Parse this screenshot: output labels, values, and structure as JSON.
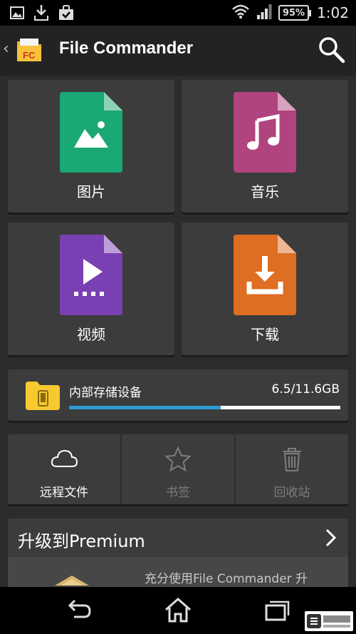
{
  "status_bar": {
    "time": "1:02",
    "battery": "95%",
    "icons": [
      "image-notification-icon",
      "download-notification-icon",
      "store-notification-icon",
      "wifi-icon",
      "signal-icon",
      "battery-icon"
    ]
  },
  "app_bar": {
    "title": "File Commander",
    "logo_text": "FC",
    "icons": [
      "back-chevron-icon",
      "app-logo-icon",
      "search-icon"
    ]
  },
  "categories": [
    {
      "label": "图片",
      "icon": "image-file-icon",
      "color": "#1aa874"
    },
    {
      "label": "音乐",
      "icon": "music-file-icon",
      "color": "#b0447e"
    },
    {
      "label": "视频",
      "icon": "video-file-icon",
      "color": "#7a3fb2"
    },
    {
      "label": "下载",
      "icon": "download-file-icon",
      "color": "#de6e22"
    }
  ],
  "storage": {
    "name": "内部存储设备",
    "size": "6.5/11.6GB",
    "used_fraction": 0.56,
    "icon": "phone-folder-icon",
    "bar_color": "#2e9ad3"
  },
  "actions": [
    {
      "label": "远程文件",
      "icon": "cloud-icon",
      "enabled": true
    },
    {
      "label": "书签",
      "icon": "star-icon",
      "enabled": false
    },
    {
      "label": "回收站",
      "icon": "trash-icon",
      "enabled": false
    }
  ],
  "premium": {
    "title": "升级到Premium",
    "subtitle": "充分使用File Commander 升",
    "icons": [
      "chevron-right-icon",
      "crown-icon"
    ]
  },
  "nav_bar": {
    "icons": [
      "back-icon",
      "home-icon",
      "recents-icon"
    ]
  }
}
